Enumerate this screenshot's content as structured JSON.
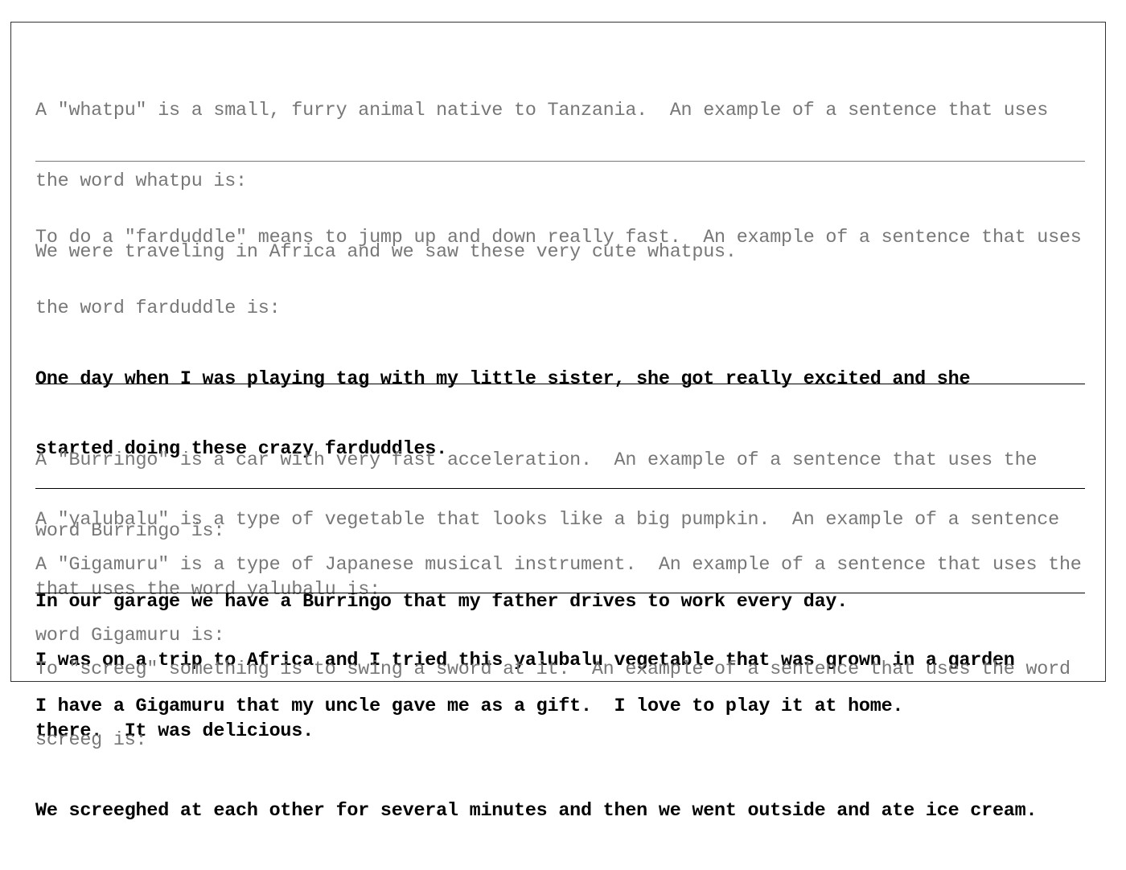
{
  "colors": {
    "prompt_text": "#777777",
    "completion_text": "#000000",
    "first_separator": "#777777",
    "separator": "#000000",
    "frame_border": "#333333"
  },
  "blocks": [
    {
      "lines": [
        {
          "type": "prompt",
          "text": "A \"whatpu\" is a small, furry animal native to Tanzania.  An example of a sentence that uses"
        },
        {
          "type": "prompt",
          "text": "the word whatpu is:"
        },
        {
          "type": "prompt",
          "text": "We were traveling in Africa and we saw these very cute whatpus."
        }
      ]
    },
    {
      "lines": [
        {
          "type": "prompt",
          "text": "To do a \"farduddle\" means to jump up and down really fast.  An example of a sentence that uses"
        },
        {
          "type": "prompt",
          "text": "the word farduddle is:"
        },
        {
          "type": "completion",
          "text": "One day when I was playing tag with my little sister, she got really excited and she"
        },
        {
          "type": "completion",
          "text": "started doing these crazy farduddles."
        },
        {
          "type": "prompt",
          "text": "A \"yalubalu\" is a type of vegetable that looks like a big pumpkin.  An example of a sentence"
        },
        {
          "type": "prompt",
          "text": "that uses the word yalubalu is:"
        },
        {
          "type": "completion",
          "text": "I was on a trip to Africa and I tried this yalubalu vegetable that was grown in a garden"
        },
        {
          "type": "completion",
          "text": "there.  It was delicious."
        }
      ]
    },
    {
      "lines": [
        {
          "type": "prompt",
          "text": "A \"Burringo\" is a car with very fast acceleration.  An example of a sentence that uses the"
        },
        {
          "type": "prompt",
          "text": "word Burringo is:"
        },
        {
          "type": "completion",
          "text": "In our garage we have a Burringo that my father drives to work every day."
        }
      ]
    },
    {
      "lines": [
        {
          "type": "prompt",
          "text": "A \"Gigamuru\" is a type of Japanese musical instrument.  An example of a sentence that uses the"
        },
        {
          "type": "prompt",
          "text": "word Gigamuru is:"
        },
        {
          "type": "completion",
          "text": "I have a Gigamuru that my uncle gave me as a gift.  I love to play it at home."
        }
      ]
    },
    {
      "lines": [
        {
          "type": "prompt",
          "text": "To \"screeg\" something is to swing a sword at it.  An example of a sentence that uses the word"
        },
        {
          "type": "prompt",
          "text": "screeg is:"
        },
        {
          "type": "completion",
          "text": "We screeghed at each other for several minutes and then we went outside and ate ice cream."
        }
      ]
    }
  ]
}
